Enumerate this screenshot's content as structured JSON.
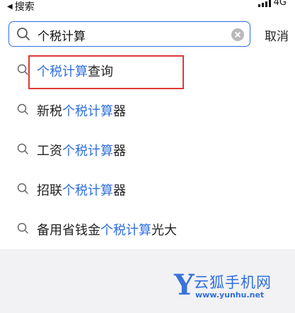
{
  "status": {
    "back_label": "搜索",
    "carrier": "4G"
  },
  "search": {
    "query": "个税计算",
    "cancel_label": "取消"
  },
  "suggestions": [
    {
      "prefix": "",
      "match": "个税计算",
      "suffix": "查询"
    },
    {
      "prefix": "新税",
      "match": "个税计算",
      "suffix": "器"
    },
    {
      "prefix": "工资",
      "match": "个税计算",
      "suffix": "器"
    },
    {
      "prefix": "招联",
      "match": "个税计算",
      "suffix": "器"
    },
    {
      "prefix": "备用省钱金",
      "match": "个税计算",
      "suffix": "光大"
    }
  ],
  "watermark": {
    "logo_letter": "Y",
    "name": "云狐手机网",
    "url": "www.yunhu.net"
  },
  "colors": {
    "accent": "#2f6fe0",
    "highlight_border": "#e03838"
  }
}
